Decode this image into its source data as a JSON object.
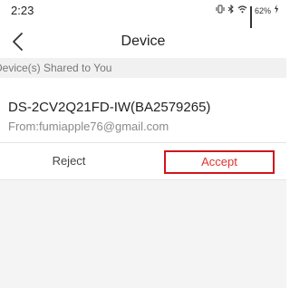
{
  "status_bar": {
    "time": "2:23",
    "battery": "62%",
    "icons": [
      "vibrate-icon",
      "bluetooth-icon",
      "wifi-icon",
      "signal-icon",
      "battery-icon"
    ]
  },
  "nav": {
    "title": "Device",
    "back_icon": "chevron-left-icon"
  },
  "section": {
    "header": "Device(s) Shared to You"
  },
  "device": {
    "name": "DS-2CV2Q21FD-IW(BA2579265)",
    "from": "From:fumiapple76@gmail.com"
  },
  "actions": {
    "reject_label": "Reject",
    "accept_label": "Accept"
  },
  "colors": {
    "accept_text": "#e0312f",
    "accept_border": "#d0161a",
    "section_bg": "#f1f1f1",
    "page_bg": "#f4f4f4"
  }
}
